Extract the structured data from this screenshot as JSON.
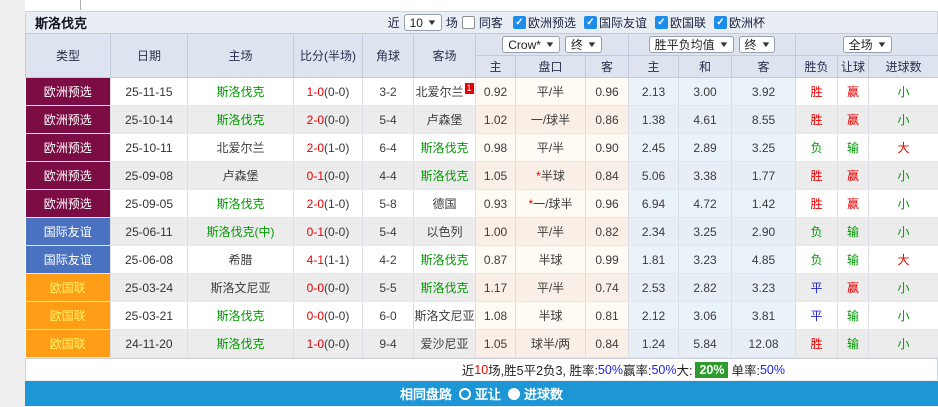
{
  "page": {
    "title": "斯洛伐克",
    "filter": {
      "near_label": "近",
      "matches_value": "10",
      "matches_unit": "场",
      "same_away": {
        "label": "同客",
        "checked": false
      },
      "competitions": [
        {
          "label": "欧洲预选",
          "checked": true
        },
        {
          "label": "国际友谊",
          "checked": true
        },
        {
          "label": "欧国联",
          "checked": true
        },
        {
          "label": "欧洲杯",
          "checked": true
        }
      ]
    }
  },
  "table": {
    "selects": {
      "asia_company": "Crow*",
      "asia_time": "终",
      "euro_type": "胜平负均值",
      "euro_time": "终",
      "scope": "全场"
    },
    "columns": [
      "类型",
      "日期",
      "主场",
      "比分(半场)",
      "角球",
      "客场",
      "主",
      "盘口",
      "客",
      "主",
      "和",
      "客",
      "胜负",
      "让球",
      "进球数"
    ],
    "type_styles": {
      "欧洲预选": {
        "bg": "#7b0c44",
        "fg": "#ffffff"
      },
      "国际友谊": {
        "bg": "#4a72c0",
        "fg": "#ffffff"
      },
      "欧国联": {
        "bg": "#ff9d17",
        "fg": "#fff263"
      }
    },
    "team_highlight_color": "#009900",
    "result_colors": {
      "胜": "#e60000",
      "平": "#2323cc",
      "负": "#009900",
      "赢": "#e60000",
      "输": "#009900",
      "大": "#e60000",
      "小": "#009900"
    },
    "rows": [
      {
        "type": "欧洲预选",
        "date": "25-11-15",
        "home": "斯洛伐克",
        "home_hl": true,
        "ft": "1-0",
        "ht": "(0-0)",
        "corner": "3-2",
        "away": "北爱尔兰",
        "away_hl": false,
        "away_badge": "1",
        "a_home": "0.92",
        "line": "平/半",
        "line_star": false,
        "a_away": "0.96",
        "e_home": "2.13",
        "e_draw": "3.00",
        "e_away": "3.92",
        "res": "胜",
        "spread": "赢",
        "goals": "小"
      },
      {
        "type": "欧洲预选",
        "date": "25-10-14",
        "home": "斯洛伐克",
        "home_hl": true,
        "ft": "2-0",
        "ht": "(0-0)",
        "corner": "5-4",
        "away": "卢森堡",
        "away_hl": false,
        "away_badge": "",
        "a_home": "1.02",
        "line": "一/球半",
        "line_star": false,
        "a_away": "0.86",
        "e_home": "1.38",
        "e_draw": "4.61",
        "e_away": "8.55",
        "res": "胜",
        "spread": "赢",
        "goals": "小"
      },
      {
        "type": "欧洲预选",
        "date": "25-10-11",
        "home": "北爱尔兰",
        "home_hl": false,
        "ft": "2-0",
        "ht": "(1-0)",
        "corner": "6-4",
        "away": "斯洛伐克",
        "away_hl": true,
        "away_badge": "",
        "a_home": "0.98",
        "line": "平/半",
        "line_star": false,
        "a_away": "0.90",
        "e_home": "2.45",
        "e_draw": "2.89",
        "e_away": "3.25",
        "res": "负",
        "spread": "输",
        "goals": "大"
      },
      {
        "type": "欧洲预选",
        "date": "25-09-08",
        "home": "卢森堡",
        "home_hl": false,
        "ft": "0-1",
        "ht": "(0-0)",
        "corner": "4-4",
        "away": "斯洛伐克",
        "away_hl": true,
        "away_badge": "",
        "a_home": "1.05",
        "line": "半球",
        "line_star": true,
        "a_away": "0.84",
        "e_home": "5.06",
        "e_draw": "3.38",
        "e_away": "1.77",
        "res": "胜",
        "spread": "赢",
        "goals": "小"
      },
      {
        "type": "欧洲预选",
        "date": "25-09-05",
        "home": "斯洛伐克",
        "home_hl": true,
        "ft": "2-0",
        "ht": "(1-0)",
        "corner": "5-8",
        "away": "德国",
        "away_hl": false,
        "away_badge": "",
        "a_home": "0.93",
        "line": "一/球半",
        "line_star": true,
        "a_away": "0.96",
        "e_home": "6.94",
        "e_draw": "4.72",
        "e_away": "1.42",
        "res": "胜",
        "spread": "赢",
        "goals": "小"
      },
      {
        "type": "国际友谊",
        "date": "25-06-11",
        "home": "斯洛伐克(中)",
        "home_hl": true,
        "ft": "0-1",
        "ht": "(0-0)",
        "corner": "5-4",
        "away": "以色列",
        "away_hl": false,
        "away_badge": "",
        "a_home": "1.00",
        "line": "平/半",
        "line_star": false,
        "a_away": "0.82",
        "e_home": "2.34",
        "e_draw": "3.25",
        "e_away": "2.90",
        "res": "负",
        "spread": "输",
        "goals": "小"
      },
      {
        "type": "国际友谊",
        "date": "25-06-08",
        "home": "希腊",
        "home_hl": false,
        "ft": "4-1",
        "ht": "(1-1)",
        "corner": "4-2",
        "away": "斯洛伐克",
        "away_hl": true,
        "away_badge": "",
        "a_home": "0.87",
        "line": "半球",
        "line_star": false,
        "a_away": "0.99",
        "e_home": "1.81",
        "e_draw": "3.23",
        "e_away": "4.85",
        "res": "负",
        "spread": "输",
        "goals": "大"
      },
      {
        "type": "欧国联",
        "date": "25-03-24",
        "home": "斯洛文尼亚",
        "home_hl": false,
        "ft": "0-0",
        "ht": "(0-0)",
        "corner": "5-5",
        "away": "斯洛伐克",
        "away_hl": true,
        "away_badge": "",
        "a_home": "1.17",
        "line": "平/半",
        "line_star": false,
        "a_away": "0.74",
        "e_home": "2.53",
        "e_draw": "2.82",
        "e_away": "3.23",
        "res": "平",
        "spread": "赢",
        "goals": "小"
      },
      {
        "type": "欧国联",
        "date": "25-03-21",
        "home": "斯洛伐克",
        "home_hl": true,
        "ft": "0-0",
        "ht": "(0-0)",
        "corner": "6-0",
        "away": "斯洛文尼亚",
        "away_hl": false,
        "away_badge": "",
        "a_home": "1.08",
        "line": "半球",
        "line_star": false,
        "a_away": "0.81",
        "e_home": "2.12",
        "e_draw": "3.06",
        "e_away": "3.81",
        "res": "平",
        "spread": "输",
        "goals": "小"
      },
      {
        "type": "欧国联",
        "date": "24-11-20",
        "home": "斯洛伐克",
        "home_hl": true,
        "ft": "1-0",
        "ht": "(0-0)",
        "corner": "9-4",
        "away": "爱沙尼亚",
        "away_hl": false,
        "away_badge": "",
        "a_home": "1.05",
        "line": "球半/两",
        "line_star": false,
        "a_away": "0.84",
        "e_home": "1.24",
        "e_draw": "5.84",
        "e_away": "12.08",
        "res": "胜",
        "spread": "输",
        "goals": "小"
      }
    ]
  },
  "summary": {
    "parts": [
      {
        "text": "近",
        "style": "plain"
      },
      {
        "text": "10",
        "style": "red"
      },
      {
        "text": "场,胜5平2负3, 胜率:",
        "style": "plain"
      },
      {
        "text": "50%",
        "style": "blue"
      },
      {
        "text": " 赢率:",
        "style": "plain"
      },
      {
        "text": "50%",
        "style": "blue"
      },
      {
        "text": " 大:",
        "style": "plain"
      },
      {
        "text": "20%",
        "style": "badge"
      },
      {
        "text": " 单率:",
        "style": "plain"
      },
      {
        "text": "50%",
        "style": "blue"
      }
    ]
  },
  "bottom_bar": {
    "title": "相同盘路",
    "options": [
      {
        "label": "亚让",
        "selected": false
      },
      {
        "label": "进球数",
        "selected": true
      }
    ]
  }
}
